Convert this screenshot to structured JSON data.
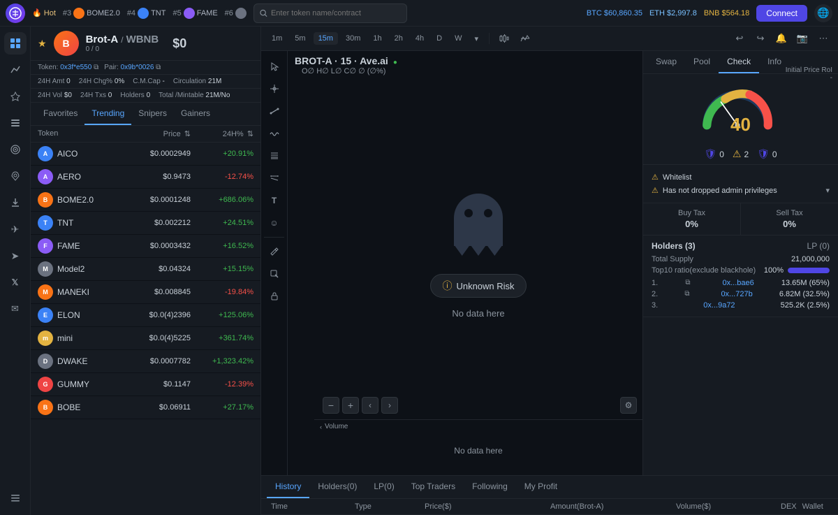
{
  "topbar": {
    "logo_text": "A",
    "hot_label": "🔥 Hot",
    "tokens": [
      {
        "rank": "#3",
        "name": "BOME2.0",
        "avatar_color": "#f97316"
      },
      {
        "rank": "#4",
        "name": "TNT",
        "avatar_color": "#3b82f6"
      },
      {
        "rank": "#5",
        "name": "FAME",
        "avatar_color": "#8b5cf6"
      },
      {
        "rank": "#6",
        "name": "...",
        "avatar_color": "#6b7280"
      }
    ],
    "search_placeholder": "Enter token name/contract",
    "btc_label": "BTC",
    "btc_price": "$60,860.35",
    "eth_label": "ETH",
    "eth_price": "$2,997.8",
    "bnb_label": "BNB",
    "bnb_price": "$564.18",
    "connect_label": "Connect"
  },
  "sidebar": {
    "icons": [
      {
        "name": "home",
        "symbol": "⊞",
        "active": true
      },
      {
        "name": "chart",
        "symbol": "📈"
      },
      {
        "name": "star",
        "symbol": "★"
      },
      {
        "name": "list",
        "symbol": "☰"
      },
      {
        "name": "target",
        "symbol": "◎"
      },
      {
        "name": "rocket",
        "symbol": "🚀"
      },
      {
        "name": "download",
        "symbol": "↓"
      },
      {
        "name": "telegram",
        "symbol": "✈"
      },
      {
        "name": "send",
        "symbol": "➤"
      },
      {
        "name": "twitter",
        "symbol": "𝕏"
      },
      {
        "name": "email",
        "symbol": "✉"
      },
      {
        "name": "settings",
        "symbol": "≡"
      }
    ]
  },
  "token_list": {
    "tabs": [
      "Favorites",
      "Trending",
      "Snipers",
      "Gainers"
    ],
    "active_tab": "Trending",
    "columns": {
      "token": "Token",
      "price": "Price",
      "change": "24H%"
    },
    "tokens": [
      {
        "name": "AICO",
        "price": "$0.0002949",
        "change": "+20.91%",
        "pos": true,
        "color": "#3b82f6"
      },
      {
        "name": "AERO",
        "price": "$0.9473",
        "change": "-12.74%",
        "pos": false,
        "color": "#8b5cf6"
      },
      {
        "name": "BOME2.0",
        "price": "$0.0001248",
        "change": "+686.06%",
        "pos": true,
        "color": "#f97316"
      },
      {
        "name": "TNT",
        "price": "$0.002212",
        "change": "+24.51%",
        "pos": true,
        "color": "#3b82f6"
      },
      {
        "name": "FAME",
        "price": "$0.0003432",
        "change": "+16.52%",
        "pos": true,
        "color": "#8b5cf6"
      },
      {
        "name": "Model2",
        "price": "$0.04324",
        "change": "+15.15%",
        "pos": true,
        "color": "#6b7280"
      },
      {
        "name": "MANEKI",
        "price": "$0.008845",
        "change": "-19.84%",
        "pos": false,
        "color": "#f97316"
      },
      {
        "name": "ELON",
        "price": "$0.0(4)2396",
        "change": "+125.06%",
        "pos": true,
        "color": "#3b82f6"
      },
      {
        "name": "mini",
        "price": "$0.0(4)5225",
        "change": "+361.74%",
        "pos": true,
        "color": "#e3b341"
      },
      {
        "name": "DWAKE",
        "price": "$0.0007782",
        "change": "+1,323.42%",
        "pos": true,
        "color": "#6b7280"
      },
      {
        "name": "GUMMY",
        "price": "$0.1147",
        "change": "-12.39%",
        "pos": false,
        "color": "#ef4444"
      },
      {
        "name": "BOBE",
        "price": "$0.06911",
        "change": "+27.17%",
        "pos": true,
        "color": "#f97316"
      }
    ]
  },
  "token_header": {
    "name": "Brot-A",
    "slash": "/",
    "pair": "WBNB",
    "score": "0 / 0",
    "price": "$0",
    "token_label": "Token:",
    "token_address": "0x3f*e550",
    "pair_label": "Pair:",
    "pair_address": "0x9b*0026",
    "h24_amt_label": "24H Amt",
    "h24_amt": "0",
    "h24_chg_label": "24H Chg%",
    "h24_chg": "0%",
    "h24_vol_label": "24H Vol",
    "h24_vol": "$0",
    "h24_txs_label": "24H Txs",
    "h24_txs": "0",
    "cmcap_label": "C.M.Cap",
    "cmcap": "-",
    "holders_label": "Holders",
    "holders": "0",
    "circulation_label": "Circulation",
    "circulation": "21M",
    "total_mintable_label": "Total /Mintable",
    "total_mintable": "21M/No",
    "initial_price_label": "Initial Price",
    "initial_price": "-",
    "roi_label": "ROI",
    "roi": "-",
    "swap_label": "Swap"
  },
  "chart": {
    "token_display": "BROT-A · 15 · Ave.ai",
    "live_dot": "●",
    "ohlc": "O∅  H∅  L∅  C∅  ∅ (∅%)",
    "time_buttons": [
      "1m",
      "5m",
      "15m",
      "30m",
      "1h",
      "2h",
      "4h",
      "D",
      "W"
    ],
    "active_time": "15m",
    "unknown_risk_label": "Unknown Risk",
    "no_data_chart": "No data here",
    "no_data_volume": "No data here",
    "volume_label": "Volume"
  },
  "right_panel": {
    "tabs": [
      "Swap",
      "Pool",
      "Check",
      "Info"
    ],
    "active_tab": "Check",
    "gauge_score": "40",
    "badges": {
      "shield_left": "0",
      "warning": "2",
      "shield_right": "0"
    },
    "security_items": [
      {
        "label": "Whitelist",
        "icon": "⚠"
      },
      {
        "label": "Has not dropped admin privileges",
        "icon": "⚠"
      }
    ],
    "buy_tax_label": "Buy Tax",
    "buy_tax": "0%",
    "sell_tax_label": "Sell Tax",
    "sell_tax": "0%",
    "holders_label": "Holders (3)",
    "lp_label": "LP (0)",
    "total_supply_label": "Total Supply",
    "total_supply": "21,000,000",
    "top10_label": "Top10 ratio(exclude blackhole)",
    "top10_pct": "100%",
    "holders_list": [
      {
        "rank": "1.",
        "addr": "0x...bae6",
        "amount": "13.65M (65%)"
      },
      {
        "rank": "2.",
        "addr": "0x...727b",
        "amount": "6.82M (32.5%)"
      },
      {
        "rank": "3.",
        "addr": "0x...9a72",
        "amount": "525.2K (2.5%)"
      }
    ],
    "initial_price_roi_title": "Initial Price RoI",
    "initial_price_roi_value": "-"
  },
  "bottom": {
    "tabs": [
      "History",
      "Holders(0)",
      "LP(0)",
      "Top Traders",
      "Following",
      "My Profit"
    ],
    "active_tab": "History",
    "columns": [
      "Time",
      "Type",
      "Price($)",
      "Amount(Brot-A)",
      "Volume($)",
      "DEX",
      "Wallet"
    ]
  }
}
